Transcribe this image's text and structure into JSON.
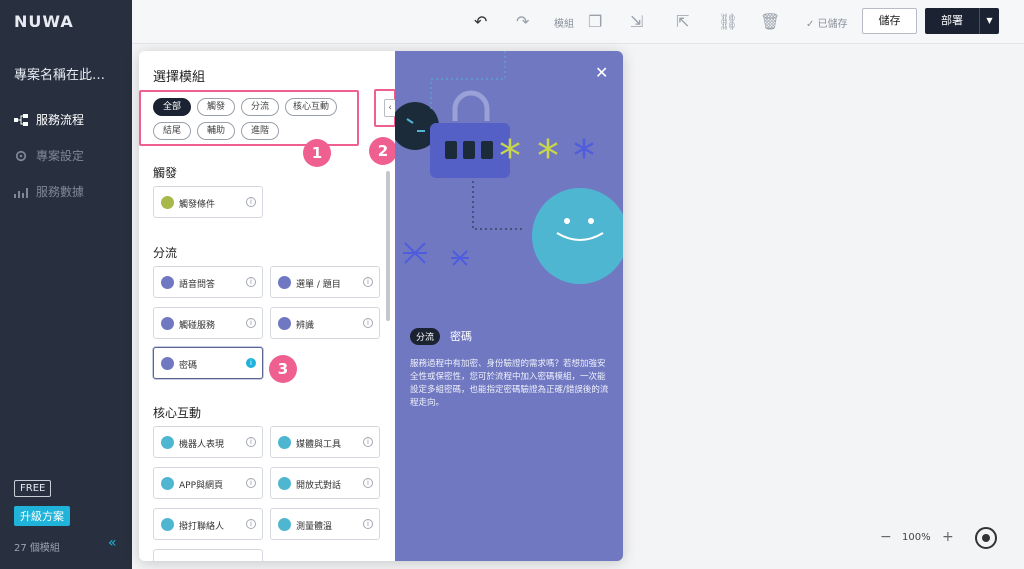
{
  "sidebar": {
    "logo": "NUWA",
    "project_name": "專案名稱在此…",
    "nav": [
      "服務流程",
      "專案設定",
      "服務數據"
    ],
    "plan_badge": "FREE",
    "upgrade_label": "升級方案",
    "module_count": "27 個模組"
  },
  "toolbar": {
    "module_label": "模組",
    "saved_label": "已儲存",
    "save_label": "儲存",
    "deploy_label": "部署"
  },
  "modal": {
    "title": "選擇模組",
    "filters": [
      "全部",
      "觸發",
      "分流",
      "核心互動",
      "結尾",
      "輔助",
      "進階"
    ],
    "sections": [
      {
        "title": "觸發",
        "items": [
          "觸發條件"
        ]
      },
      {
        "title": "分流",
        "items": [
          "語音問答",
          "選單 / 題目",
          "觸碰服務",
          "辨識",
          "密碼"
        ]
      },
      {
        "title": "核心互動",
        "items": [
          "機器人表現",
          "媒體與工具",
          "APP與網頁",
          "開放式對話",
          "撥打聯絡人",
          "測量體溫"
        ]
      }
    ],
    "markers": [
      "1",
      "2",
      "3"
    ],
    "info_glyph": "i",
    "detail": {
      "tag": "分流",
      "title": "密碼",
      "description": "服務過程中有加密、身份驗證的需求嗎？若想加強安全性或保密性，您可於流程中加入密碼模組，一次能設定多組密碼，也能指定密碼驗證為正確/錯誤後的流程走向。"
    }
  },
  "zoom": {
    "value": "100%"
  },
  "colors": {
    "accent": "#1fb3d9",
    "sidebar": "#283040",
    "panel": "#7078c1",
    "marker": "#ef5f8f"
  }
}
